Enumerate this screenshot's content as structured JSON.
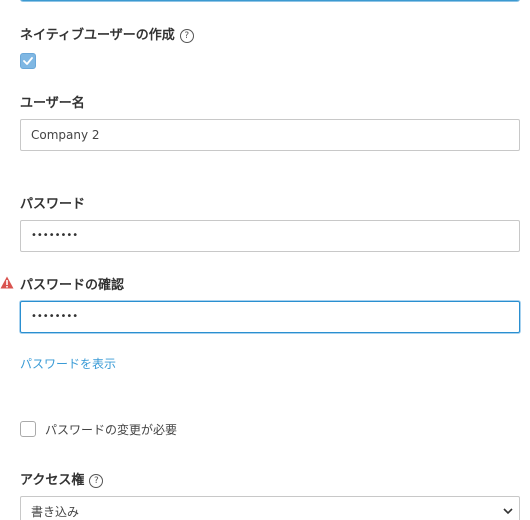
{
  "form": {
    "create_native_user": {
      "label": "ネイティブユーザーの作成",
      "help_icon": "question-circle-icon",
      "checked": true
    },
    "username": {
      "label": "ユーザー名",
      "value": "Company 2"
    },
    "password": {
      "label": "パスワード",
      "value": "••••••••"
    },
    "password_confirm": {
      "label": "パスワードの確認",
      "value": "••••••••",
      "warning_icon": "warning-triangle-icon"
    },
    "show_password_link": "パスワードを表示",
    "require_password_change": {
      "label": "パスワードの変更が必要",
      "checked": false
    },
    "access_rights": {
      "label": "アクセス権",
      "help_icon": "question-circle-icon",
      "selected": "書き込み"
    }
  },
  "colors": {
    "accent": "#3a9bd6",
    "focus_border": "#2a8fd0",
    "warning": "#d9534f",
    "checkbox_checked": "#7fb7e3"
  }
}
